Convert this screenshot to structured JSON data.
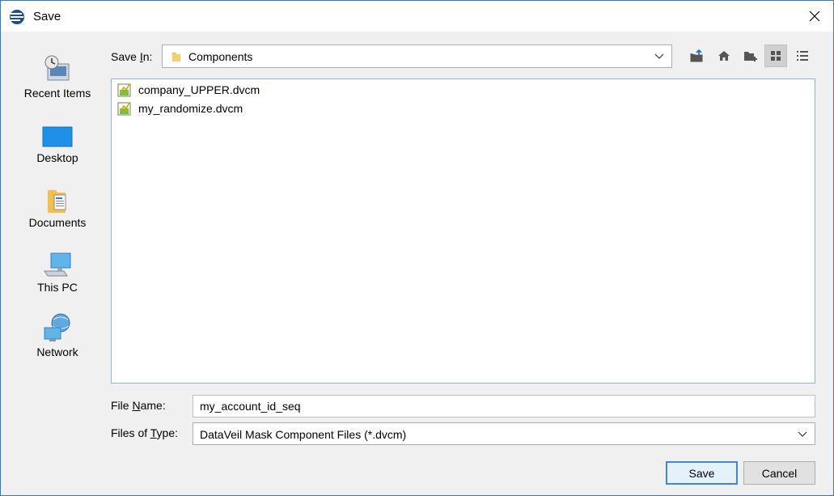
{
  "window": {
    "title": "Save"
  },
  "places": [
    {
      "label": "Recent Items",
      "icon": "recent-items-icon"
    },
    {
      "label": "Desktop",
      "icon": "desktop-icon"
    },
    {
      "label": "Documents",
      "icon": "documents-icon"
    },
    {
      "label": "This PC",
      "icon": "this-pc-icon"
    },
    {
      "label": "Network",
      "icon": "network-icon"
    }
  ],
  "save_in": {
    "label_pre": "Save ",
    "label_key": "I",
    "label_post": "n:",
    "value": "Components"
  },
  "toolbar": [
    "up-folder-icon",
    "home-icon",
    "new-folder-icon",
    "list-view-icon",
    "details-view-icon"
  ],
  "files": [
    {
      "name": "company_UPPER.dvcm"
    },
    {
      "name": "my_randomize.dvcm"
    }
  ],
  "file_name": {
    "label_pre": "File ",
    "label_key": "N",
    "label_post": "ame:",
    "value": "my_account_id_seq"
  },
  "file_type": {
    "label_pre": "Files of ",
    "label_key": "T",
    "label_post": "ype:",
    "value": "DataVeil Mask Component Files (*.dvcm)"
  },
  "buttons": {
    "save": "Save",
    "cancel": "Cancel"
  },
  "colors": {
    "accent": "#2b79d0",
    "selection_border": "#3c87d6"
  }
}
